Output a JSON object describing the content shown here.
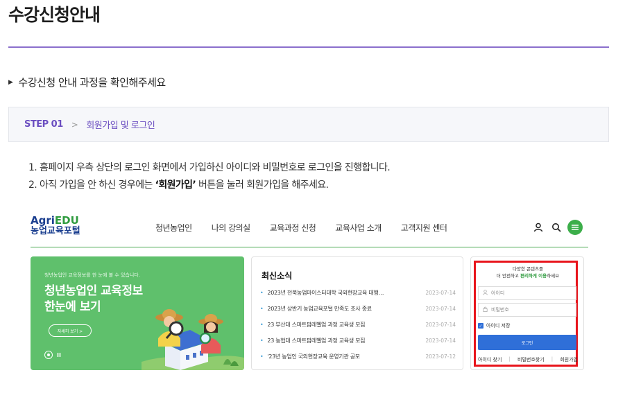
{
  "page": {
    "title": "수강신청안내",
    "section_heading": "수강신청 안내 과정을 확인해주세요",
    "section_arrow": "▶",
    "colors": {
      "accent": "#8a6fcc",
      "step_text": "#6a4dc0",
      "highlight_box": "#e8141b"
    }
  },
  "step": {
    "number": "STEP 01",
    "separator": ">",
    "label": "회원가입 및 로그인"
  },
  "instructions": {
    "line1": "1. 홈페이지 우측 상단의 로그인 화면에서 가입하신 아이디와 비밀번호로 로그인을 진행합니다.",
    "line2_pre": "2. 아직 가입을 안 하신 경우에는 ",
    "line2_bold": "‘회원가입’",
    "line2_post": " 버튼을 눌러 회원가입을 해주세요."
  },
  "screenshot": {
    "logo": {
      "agri": "Agri",
      "edu": "EDU",
      "sub": "농업교육포털"
    },
    "nav": [
      "청년농업인",
      "나의 강의실",
      "교육과정 신청",
      "교육사업 소개",
      "고객지원 센터"
    ],
    "header_icons": [
      "user-icon",
      "search-icon",
      "menu-icon"
    ],
    "banner": {
      "subtitle": "청년농업인 교육정보를 한 눈에 볼 수 있습니다.",
      "title_line1": "청년농업인 교육정보",
      "title_line2": "한눈에 보기",
      "more_button": "자세히 보기  >",
      "pause": "II"
    },
    "news": {
      "title": "최신소식",
      "items": [
        {
          "text": "2023년 전북농업마이스터대학 국외현장교육 대행…",
          "date": "2023-07-14"
        },
        {
          "text": "2023년 상반기 농업교육포털 만족도 조사 종료",
          "date": "2023-07-14"
        },
        {
          "text": "23 부산대 스마트팜레벨업 과정 교육생 모집",
          "date": "2023-07-14"
        },
        {
          "text": "23 농협대 스마트팜레벨업 과정 교육생 모집",
          "date": "2023-07-14"
        },
        {
          "text": "'23년 농업인 국외현장교육 운영기관 공모",
          "date": "2023-07-12"
        }
      ]
    },
    "login": {
      "msg_line1": "다양한 콘텐츠를",
      "msg_line2_pre": "더 안전하고 ",
      "msg_line2_green": "편리하게 이용",
      "msg_line2_post": "하세요",
      "id_placeholder": "아이디",
      "pw_placeholder": "비밀번호",
      "save_id": "아이디 저장",
      "login_button": "로그인",
      "find_id": "아이디 찾기",
      "find_pw": "비밀번호찾기",
      "signup": "회원가입"
    }
  }
}
